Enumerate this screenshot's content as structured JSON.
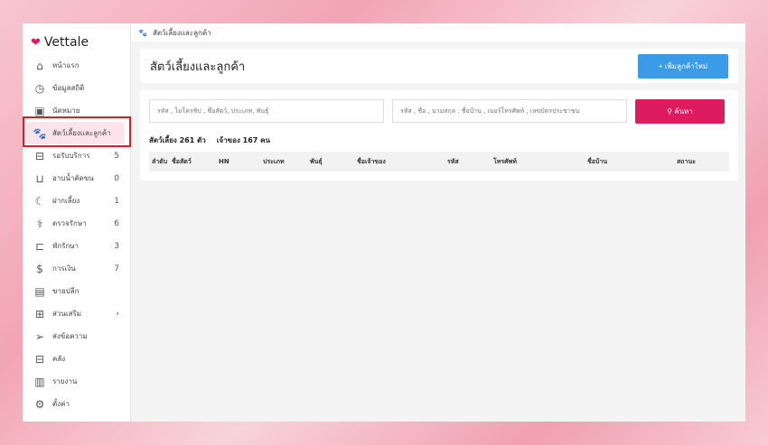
{
  "brand": "Vettale",
  "sidebar": {
    "items": [
      {
        "label": "หน้าแรก",
        "icon": "home-icon",
        "glyph": "⌂",
        "count": ""
      },
      {
        "label": "ข้อมูลสถิติ",
        "icon": "dashboard-icon",
        "glyph": "◷",
        "count": ""
      },
      {
        "label": "นัดหมาย",
        "icon": "calendar-icon",
        "glyph": "▣",
        "count": ""
      },
      {
        "label": "สัตว์เลี้ยงและลูกค้า",
        "icon": "paw-icon",
        "glyph": "🐾",
        "count": ""
      },
      {
        "label": "รอรับบริการ",
        "icon": "sofa-icon",
        "glyph": "⊟",
        "count": "5"
      },
      {
        "label": "อาบน้ำตัดขน",
        "icon": "bathtub-icon",
        "glyph": "⊔",
        "count": "0"
      },
      {
        "label": "ฝากเลี้ยง",
        "icon": "moon-icon",
        "glyph": "☾",
        "count": "1"
      },
      {
        "label": "ตรวจรักษา",
        "icon": "stethoscope-icon",
        "glyph": "⚕",
        "count": "6"
      },
      {
        "label": "พักรักษา",
        "icon": "bed-icon",
        "glyph": "⊏",
        "count": "3"
      },
      {
        "label": "การเงิน",
        "icon": "money-hand-icon",
        "glyph": "$",
        "count": "7"
      },
      {
        "label": "ขายปลีก",
        "icon": "cash-register-icon",
        "glyph": "▤",
        "count": ""
      },
      {
        "label": "ส่วนเสริม",
        "icon": "plus-square-icon",
        "glyph": "⊞",
        "count": "›"
      },
      {
        "label": "ส่งข้อความ",
        "icon": "send-icon",
        "glyph": "➢",
        "count": ""
      },
      {
        "label": "คลัง",
        "icon": "archive-icon",
        "glyph": "⊟",
        "count": ""
      },
      {
        "label": "รายงาน",
        "icon": "bar-chart-icon",
        "glyph": "▥",
        "count": ""
      },
      {
        "label": "ตั้งค่า",
        "icon": "gear-icon",
        "glyph": "⚙",
        "count": ""
      }
    ]
  },
  "breadcrumb": "สัตว์เลี้ยงและลูกค้า",
  "page_title": "สัตว์เลี้ยงและลูกค้า",
  "add_button": "+ เพิ่มลูกค้าใหม่",
  "search": {
    "pet_placeholder": "รหัส , ไมโครชิป , ชื่อสัตว์, ประเภท, พันธุ์",
    "owner_placeholder": "รหัส , ชื่อ , นามสกุล , ชื่อบ้าน , เบอร์โทรศัพท์ , เลขบัตรประชาชน",
    "button": "⚲ ค้นหา"
  },
  "summary": {
    "pets": "สัตว์เลี้ยง 261 ตัว",
    "owners": "เจ้าของ 167 คน"
  },
  "table": {
    "columns": [
      "ลำดับ",
      "ชื่อสัตว์",
      "HN",
      "ประเภท",
      "พันธุ์",
      "ชื่อเจ้าของ",
      "รหัส",
      "โทรศัพท์",
      "ชื่อบ้าน",
      "สถานะ"
    ]
  },
  "colors": {
    "accent": "#dd1c60",
    "primary": "#3a9be8",
    "active_bg": "#fde3ec",
    "highlight": "#e51c1c"
  }
}
